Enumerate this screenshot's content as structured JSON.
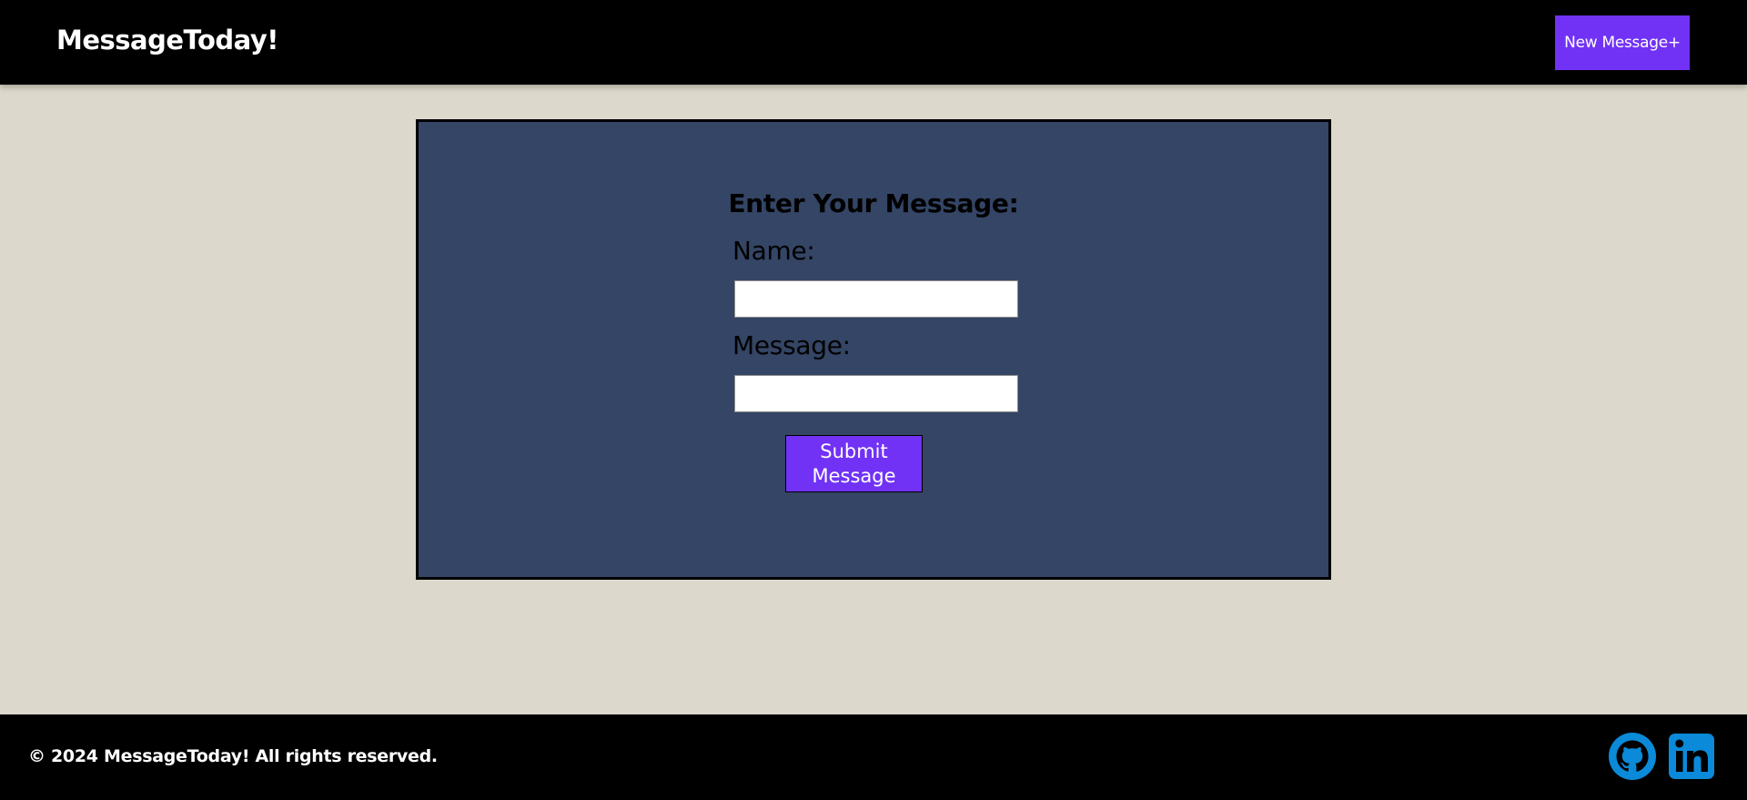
{
  "header": {
    "logo": "MessageToday!",
    "new_message_label": "New Message+"
  },
  "form": {
    "title": "Enter Your Message:",
    "name_label": "Name:",
    "name_value": "",
    "message_label": "Message:",
    "message_value": "",
    "submit_label": "Submit Message"
  },
  "footer": {
    "copyright": "© 2024 MessageToday! All rights reserved.",
    "social_icons": [
      "github-icon",
      "linkedin-icon"
    ]
  },
  "colors": {
    "accent": "#7132f5",
    "panel": "#344565",
    "background": "#dcd8cb",
    "bar": "#000000",
    "social_icon": "#0a8ad8"
  }
}
